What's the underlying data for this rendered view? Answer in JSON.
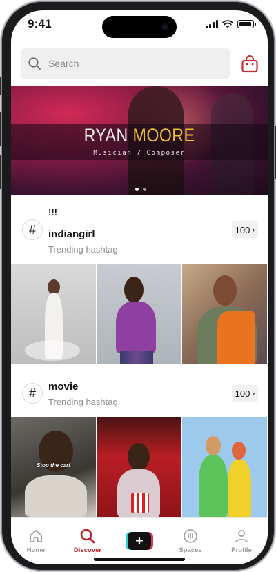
{
  "status": {
    "time": "9:41"
  },
  "search": {
    "placeholder": "Search"
  },
  "banner": {
    "title_first": "RYAN",
    "title_second": "MOORE",
    "subtitle": "Musician / Composer"
  },
  "hashtags": [
    {
      "prefix": "!!!",
      "name": "indiangirl",
      "subtitle": "Trending hashtag",
      "count": "100",
      "thumbnails": [
        {
          "icon": "photo-woman-white-dress"
        },
        {
          "icon": "photo-woman-purple-sweater"
        },
        {
          "icon": "photo-woman-orange-saree"
        }
      ]
    },
    {
      "name": "movie",
      "subtitle": "Trending hashtag",
      "count": "100",
      "thumbnails": [
        {
          "icon": "photo-man-shouting",
          "caption": "Stop the car!"
        },
        {
          "icon": "photo-woman-cinema-popcorn"
        },
        {
          "icon": "photo-couple-popcorn"
        }
      ]
    }
  ],
  "tabbar": {
    "items": [
      {
        "label": "Home",
        "icon": "home-icon"
      },
      {
        "label": "Discover",
        "icon": "search-icon",
        "active": true
      },
      {
        "label": "",
        "icon": "plus-icon"
      },
      {
        "label": "Spaces",
        "icon": "spaces-icon"
      },
      {
        "label": "Profile",
        "icon": "profile-icon"
      }
    ]
  },
  "colors": {
    "accent": "#b8252a",
    "highlight": "#f3c12b",
    "cyan": "#2ed3da",
    "pink": "#e7345a"
  }
}
